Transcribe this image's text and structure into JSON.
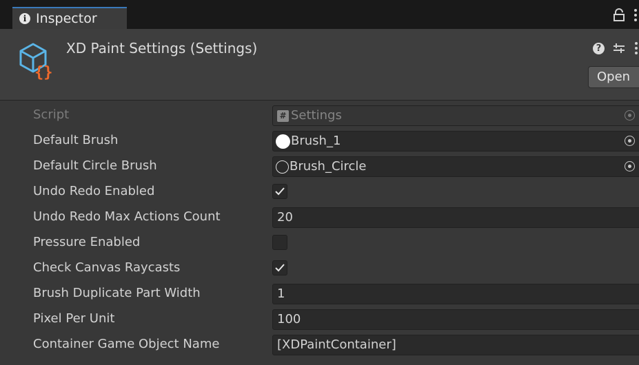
{
  "tab": {
    "label": "Inspector",
    "icon": "info-icon"
  },
  "header": {
    "title": "XD Paint Settings (Settings)",
    "open_button": "Open"
  },
  "fields": {
    "script": {
      "label": "Script",
      "value": "Settings"
    },
    "default_brush": {
      "label": "Default Brush",
      "value": "Brush_1"
    },
    "default_circle_brush": {
      "label": "Default Circle Brush",
      "value": "Brush_Circle"
    },
    "undo_redo_enabled": {
      "label": "Undo Redo Enabled",
      "checked": true
    },
    "undo_redo_max": {
      "label": "Undo Redo Max Actions Count",
      "value": "20"
    },
    "pressure_enabled": {
      "label": "Pressure Enabled",
      "checked": false
    },
    "check_canvas_raycasts": {
      "label": "Check Canvas Raycasts",
      "checked": true
    },
    "brush_duplicate_part_width": {
      "label": "Brush Duplicate Part Width",
      "value": "1"
    },
    "pixel_per_unit": {
      "label": "Pixel Per Unit",
      "value": "100"
    },
    "container_name": {
      "label": "Container Game Object Name",
      "value": "[XDPaintContainer]"
    }
  },
  "colors": {
    "background": "#383838",
    "tab_accent": "#3a79bb",
    "asset_icon_blue": "#5ab4e6",
    "asset_icon_orange": "#f06a2c"
  }
}
